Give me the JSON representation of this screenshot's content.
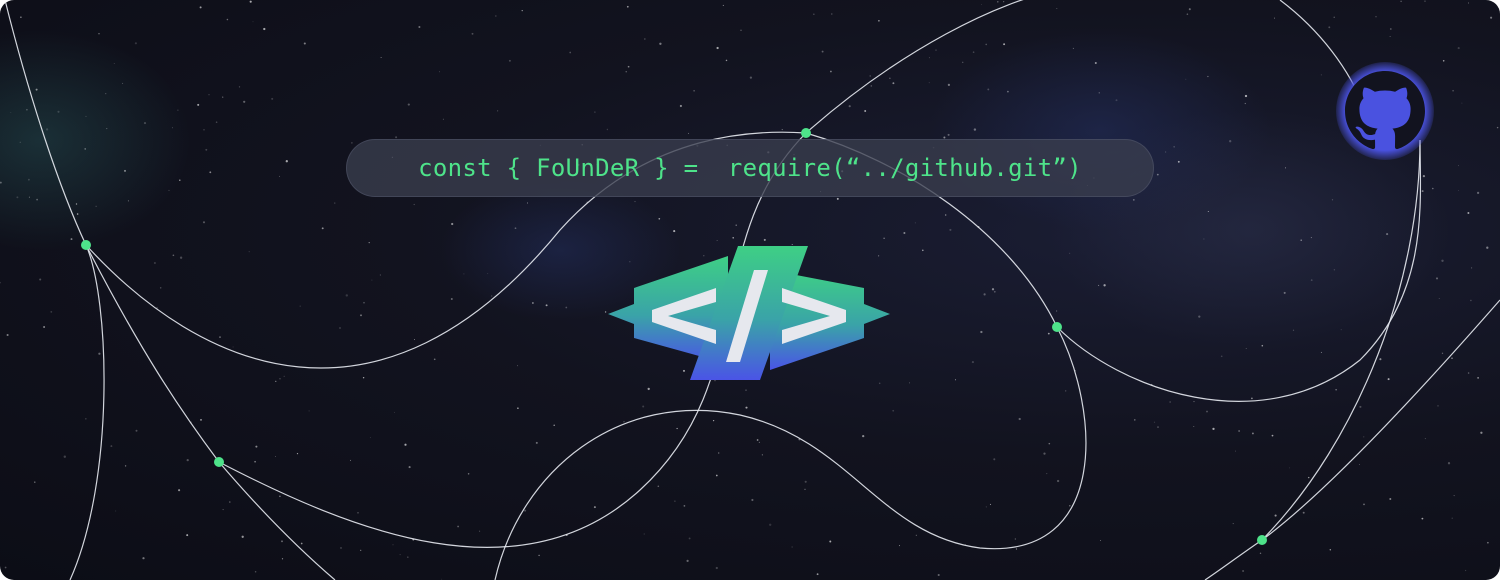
{
  "banner": {
    "code_line": "const { FoUnDeR } =  require(“../github.git”)"
  },
  "icons": {
    "center_logo": "code-brackets-icon",
    "corner_logo": "github-icon"
  },
  "colors": {
    "background": "#0e0f1a",
    "accent_green": "#4ee38a",
    "logo_gradient_top": "#3ecf85",
    "logo_gradient_bottom": "#4a54e6",
    "github_badge": "#4a52e0",
    "network_line": "#ffffff",
    "network_node": "#4ee38a"
  }
}
